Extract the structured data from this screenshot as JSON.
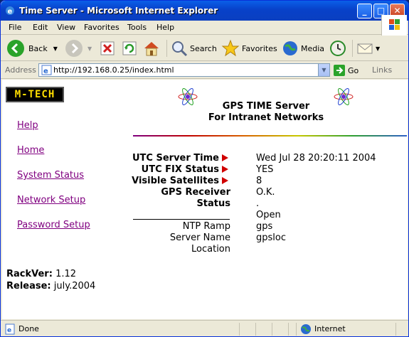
{
  "window": {
    "title": "Time Server - Microsoft Internet Explorer"
  },
  "menu": [
    "File",
    "Edit",
    "View",
    "Favorites",
    "Tools",
    "Help"
  ],
  "toolbar": {
    "back": "Back",
    "search": "Search",
    "favorites": "Favorites",
    "media": "Media"
  },
  "address": {
    "label": "Address",
    "url": "http://192.168.0.25/index.html",
    "go": "Go",
    "links": "Links"
  },
  "page": {
    "logo": "M-TECH",
    "heading_line1": "GPS TIME Server",
    "heading_line2": "For Intranet Networks",
    "nav": [
      "Help",
      "Home",
      "System Status",
      "Network Setup",
      "Password Setup"
    ],
    "status_rows": [
      {
        "label": "UTC Server Time",
        "value": "Wed Jul 28 20:20:11 2004"
      },
      {
        "label": "UTC FIX Status",
        "value": "YES"
      },
      {
        "label": "Visible Satellites",
        "value": "8"
      },
      {
        "label": "GPS Receiver",
        "value": "O.K."
      },
      {
        "label": "Status",
        "value": "."
      }
    ],
    "extra_value": "Open",
    "ntp_rows": [
      {
        "label": "NTP Ramp",
        "value": "gps"
      },
      {
        "label": "Server Name",
        "value": "gpsloc"
      },
      {
        "label": "Location",
        "value": ""
      }
    ],
    "rackver_label": "RackVer:",
    "rackver_value": "1.12",
    "release_label": "Release:",
    "release_value": "july.2004"
  },
  "statusbar": {
    "left": "Done",
    "zone": "Internet"
  }
}
